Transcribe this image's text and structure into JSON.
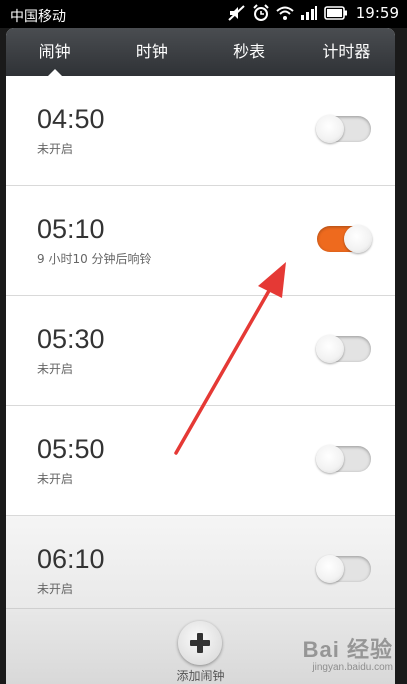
{
  "status_bar": {
    "carrier": "中国移动",
    "time": "19:59",
    "icons": [
      "mute-icon",
      "alarm-icon",
      "wifi-icon",
      "signal-icon",
      "battery-icon"
    ]
  },
  "tabs": [
    {
      "label": "闹钟",
      "active": true
    },
    {
      "label": "时钟",
      "active": false
    },
    {
      "label": "秒表",
      "active": false
    },
    {
      "label": "计时器",
      "active": false
    }
  ],
  "alarms": [
    {
      "time": "04:50",
      "status": "未开启",
      "enabled": false
    },
    {
      "time": "05:10",
      "status": "9 小时10 分钟后响铃",
      "enabled": true
    },
    {
      "time": "05:30",
      "status": "未开启",
      "enabled": false
    },
    {
      "time": "05:50",
      "status": "未开启",
      "enabled": false
    },
    {
      "time": "06:10",
      "status": "未开启",
      "enabled": false
    }
  ],
  "bottom": {
    "add_label": "添加闹钟"
  },
  "watermark": {
    "logo": "Bai 经验",
    "url": "jingyan.baidu.com"
  },
  "colors": {
    "accent": "#ee6a1e",
    "tabbar": "#3a3d41",
    "annotation_arrow": "#e53935"
  }
}
